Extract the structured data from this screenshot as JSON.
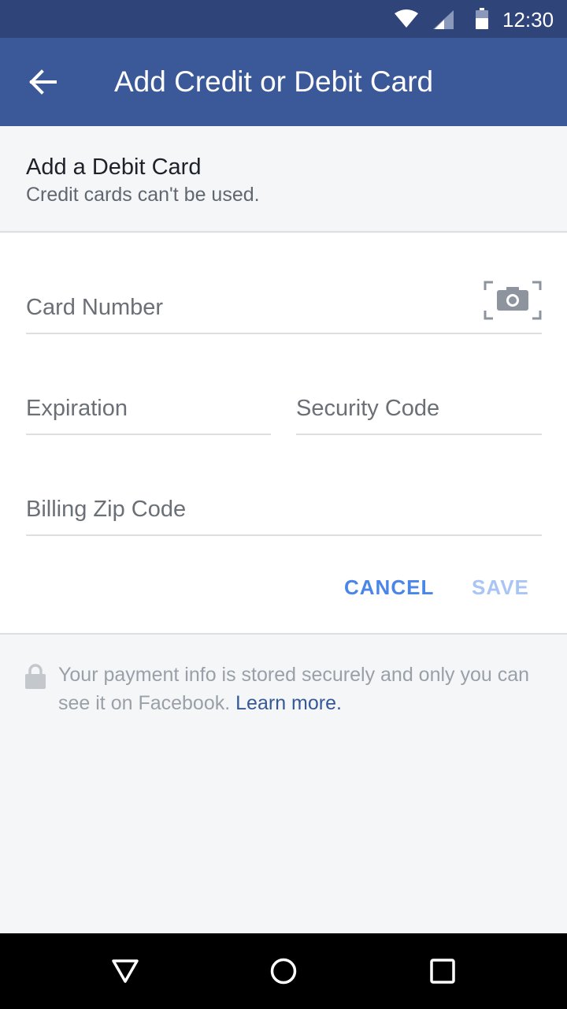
{
  "status_bar": {
    "time": "12:30",
    "icons": [
      "wifi-icon",
      "cell-signal-icon",
      "battery-icon"
    ]
  },
  "app_bar": {
    "back_icon": "arrow-left-icon",
    "title": "Add Credit or Debit Card"
  },
  "section": {
    "heading": "Add a Debit Card",
    "subheading": "Credit cards can't be used."
  },
  "form": {
    "card_number_placeholder": "Card Number",
    "scan_icon": "camera-scan-icon",
    "expiration_placeholder": "Expiration",
    "security_code_placeholder": "Security Code",
    "zip_placeholder": "Billing Zip Code",
    "cancel_label": "CANCEL",
    "save_label": "SAVE"
  },
  "footer": {
    "lock_icon": "lock-icon",
    "note": "Your payment info is stored securely and only you can see it on Facebook.",
    "learn_more": "Learn more."
  },
  "nav_bar": {
    "icons": [
      "triangle-back-icon",
      "circle-home-icon",
      "square-recents-icon"
    ]
  },
  "colors": {
    "status_bar": "#2f4478",
    "app_bar": "#3b5998",
    "accent": "#4a86e8",
    "link": "#365899",
    "disabled": "#a9c5f3"
  }
}
